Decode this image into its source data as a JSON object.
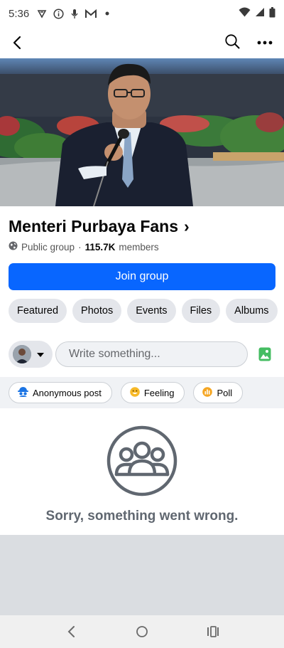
{
  "status_bar": {
    "time": "5:36",
    "icons": [
      "vpn-key-icon",
      "info-icon",
      "microphone-icon",
      "gmail-icon",
      "dot-icon"
    ],
    "right_icons": [
      "wifi-icon",
      "signal-icon",
      "battery-icon"
    ]
  },
  "top_bar": {
    "back_icon": "back-arrow-icon",
    "actions": [
      "search-icon",
      "more-icon"
    ]
  },
  "group": {
    "name": "Menteri Purbaya Fans",
    "name_chevron": "›",
    "privacy": "Public group",
    "separator": "·",
    "members_count": "115.7K",
    "members_label": "members"
  },
  "join_button": {
    "label": "Join group"
  },
  "tabs": [
    "Featured",
    "Photos",
    "Events",
    "Files",
    "Albums"
  ],
  "composer": {
    "placeholder": "Write something...",
    "photo_icon": "photo-icon"
  },
  "chips": [
    {
      "label": "Anonymous post",
      "icon": "anonymous-icon",
      "color": "#1b74e4"
    },
    {
      "label": "Feeling",
      "icon": "feeling-icon",
      "color": "#f7b928"
    },
    {
      "label": "Poll",
      "icon": "poll-icon",
      "color": "#f5a623"
    }
  ],
  "error": {
    "message": "Sorry, something went wrong.",
    "icon": "group-icon"
  },
  "nav_bar": [
    "nav-back-icon",
    "nav-home-icon",
    "nav-recents-icon"
  ],
  "colors": {
    "primary": "#0866ff",
    "chip_bg": "#e4e6eb",
    "muted_text": "#606770",
    "feed_bg": "#dadde1"
  }
}
